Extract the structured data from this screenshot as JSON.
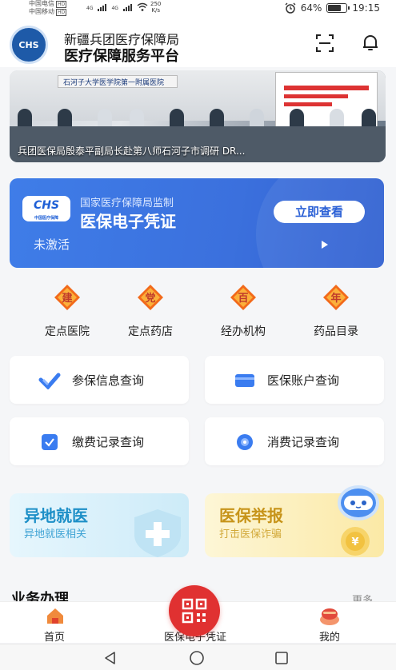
{
  "status_bar": {
    "carrier1": "中国电信",
    "carrier2": "中国移动",
    "hd": "HD",
    "net1": "4G",
    "net2": "4G",
    "speed_value": "250",
    "speed_unit": "K/s",
    "battery": "64%",
    "battery_level": 0.64,
    "time": "19:15"
  },
  "header": {
    "logo_text": "CHS",
    "org_line1": "新疆兵团医疗保障局",
    "org_line2": "医疗保障服务平台",
    "scan_icon": "scan-icon",
    "bell_icon": "bell-icon"
  },
  "banner": {
    "sign_text": "石河子大学医学院第一附属医院",
    "caption": "兵团医保局殷泰平副局长赴第八师石河子市调研 DR..."
  },
  "credential_card": {
    "supervised_by": "国家医疗保障局监制",
    "title": "医保电子凭证",
    "button": "立即查看",
    "status": "未激活",
    "logo_text": "CHS",
    "logo_sub": "中国医疗保障"
  },
  "quick_entries": [
    {
      "label": "定点医院",
      "icon": "hospital-icon",
      "badge": "建"
    },
    {
      "label": "定点药店",
      "icon": "pharmacy-icon",
      "badge": "党"
    },
    {
      "label": "经办机构",
      "icon": "agency-icon",
      "badge": "百"
    },
    {
      "label": "药品目录",
      "icon": "drug-catalog-icon",
      "badge": "年"
    }
  ],
  "query_tiles": [
    {
      "label": "参保信息查询",
      "icon": "insurance-info-icon"
    },
    {
      "label": "医保账户查询",
      "icon": "account-card-icon"
    },
    {
      "label": "缴费记录查询",
      "icon": "payment-record-icon"
    },
    {
      "label": "消费记录查询",
      "icon": "consumption-record-icon"
    }
  ],
  "promos": [
    {
      "title": "异地就医",
      "subtitle": "异地就医相关"
    },
    {
      "title": "医保举报",
      "subtitle": "打击医保诈骗"
    }
  ],
  "section": {
    "title": "业务办理",
    "more": "更多"
  },
  "tabbar": {
    "home": "首页",
    "credential": "医保电子凭证",
    "mine": "我的"
  },
  "colors": {
    "primary_blue": "#3b70dd",
    "accent_red": "#e03131",
    "promo_blue": "#dff1fb",
    "promo_yellow": "#fdf2c4"
  }
}
